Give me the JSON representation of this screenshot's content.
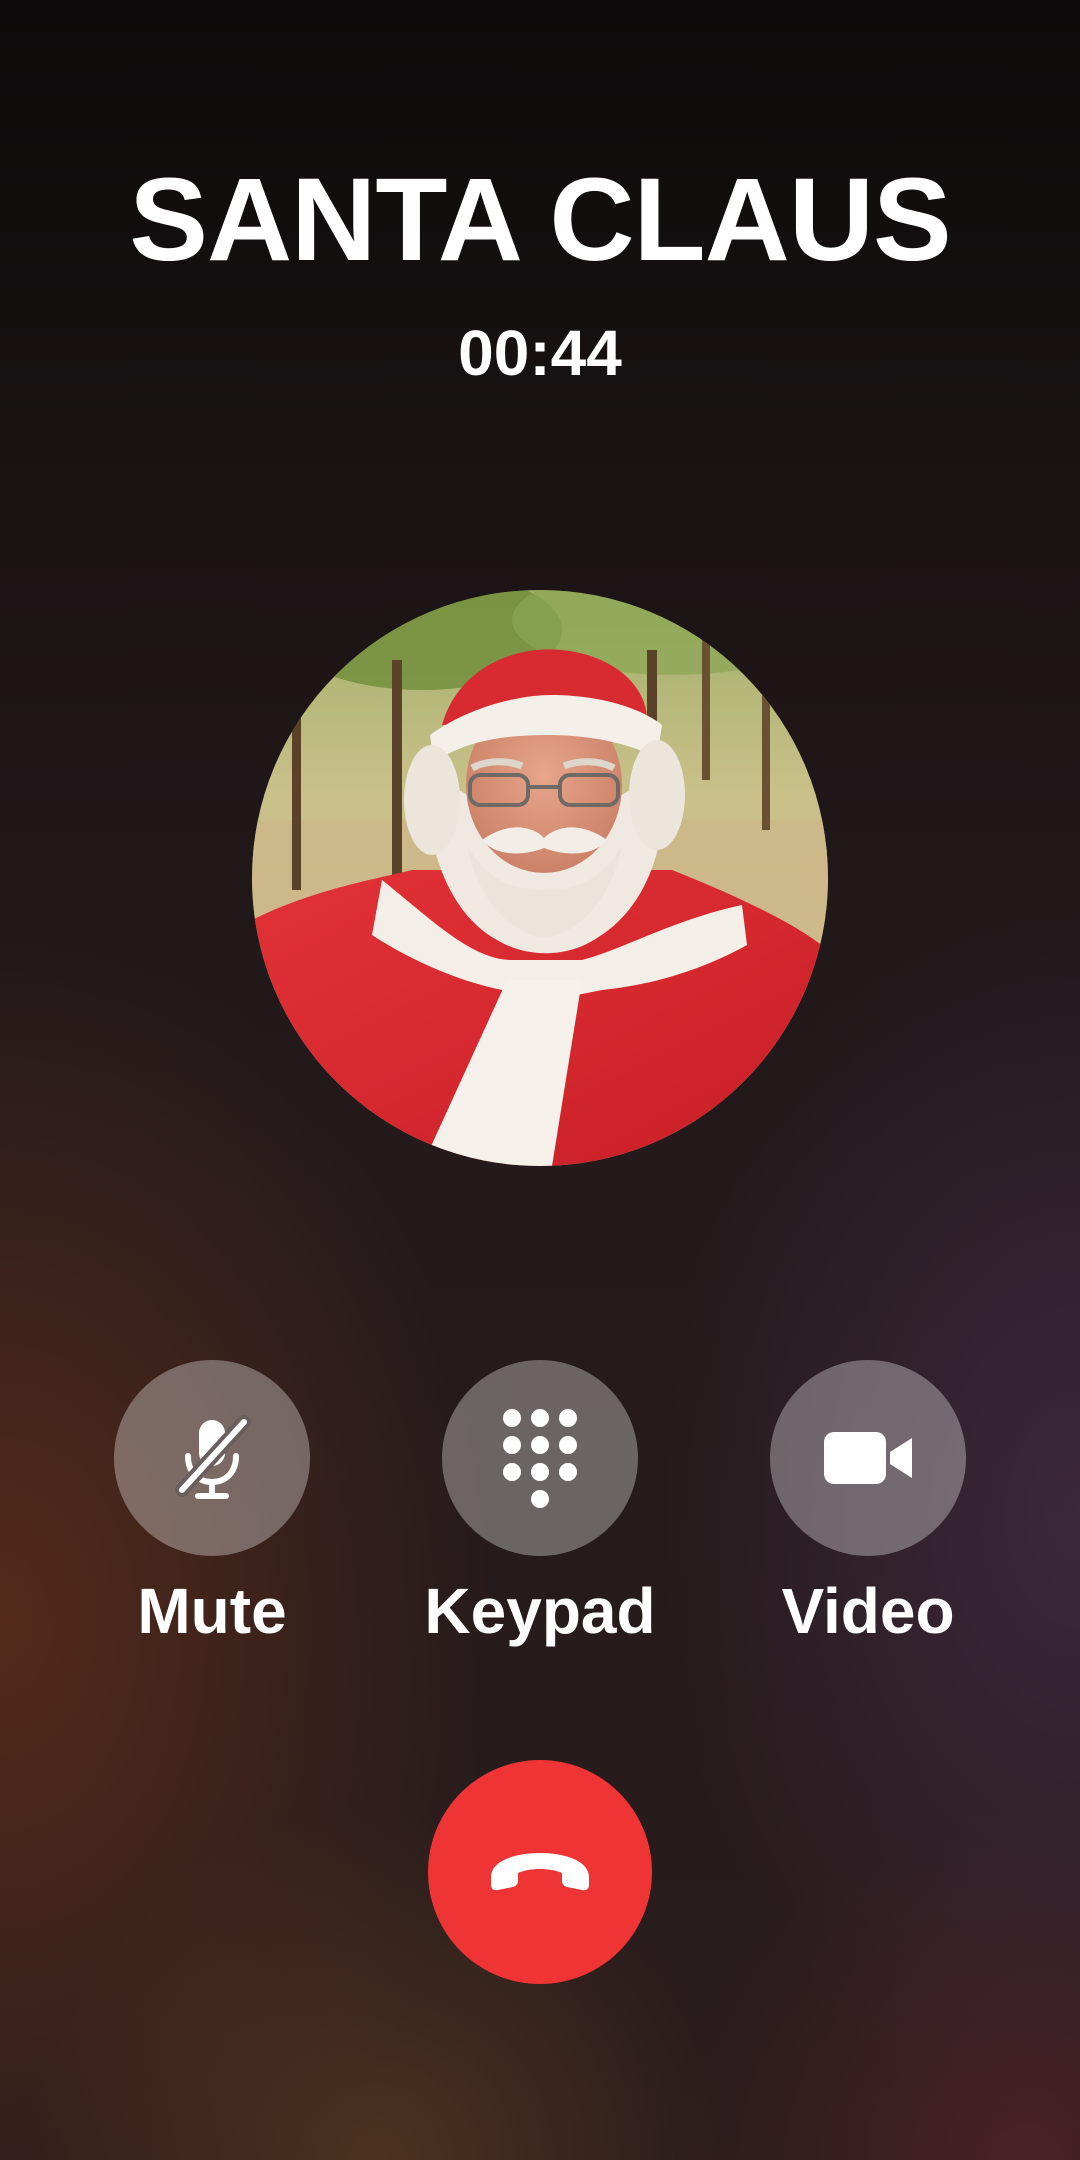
{
  "call": {
    "caller_name": "SANTA CLAUS",
    "duration": "00:44",
    "avatar_icon": "santa-claus-photo"
  },
  "controls": [
    {
      "label": "Mute",
      "icon": "mic-off-icon"
    },
    {
      "label": "Keypad",
      "icon": "keypad-icon"
    },
    {
      "label": "Video",
      "icon": "video-camera-icon"
    }
  ],
  "end_call": {
    "icon": "phone-hangup-icon",
    "color": "#ee3434"
  },
  "colors": {
    "control_bg": "rgba(255,255,255,0.32)",
    "text": "#ffffff"
  }
}
